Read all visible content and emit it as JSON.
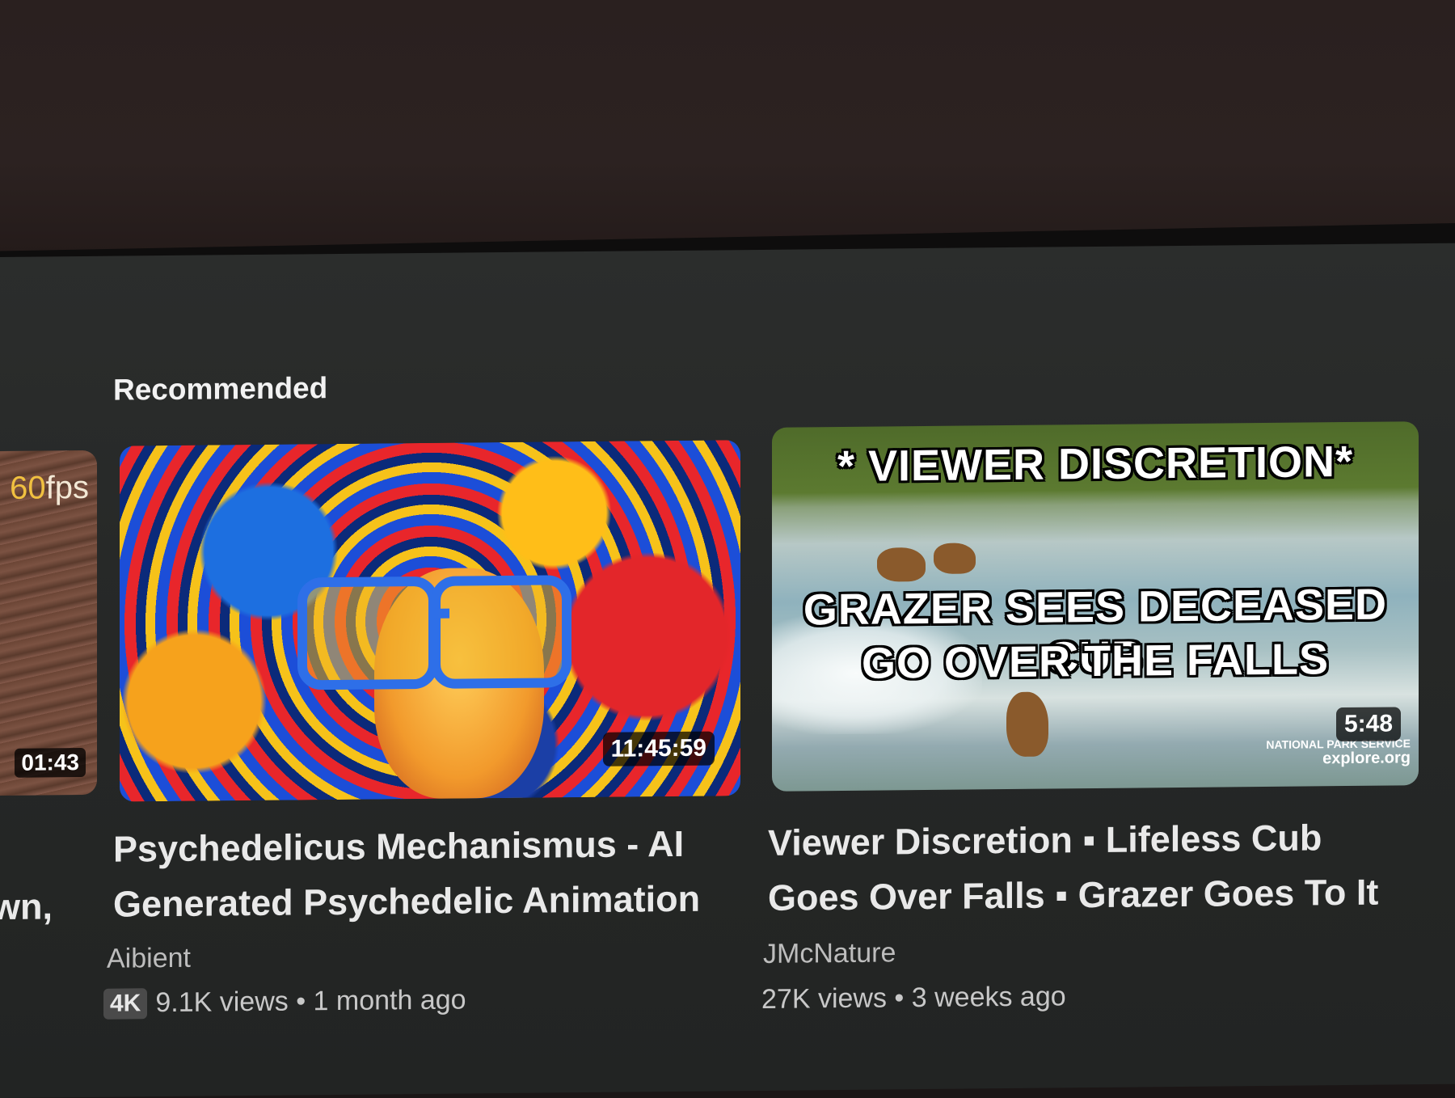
{
  "shelf": {
    "title": "Recommended"
  },
  "partial_video": {
    "quality": "60fps",
    "quality_prefix": "60",
    "quality_suffix": "fps",
    "duration": "01:43",
    "title_fragment": "wn,"
  },
  "videos": [
    {
      "title_line1": "Psychedelicus Mechanismus - AI",
      "title_line2": "Generated Psychedelic Animation",
      "channel": "Aibient",
      "badge": "4K",
      "meta": "9.1K views • 1 month ago",
      "duration": "11:45:59",
      "thumbnail_icon": "psychedelic-art-thumbnail"
    },
    {
      "title_line1": "Viewer Discretion ▪ Lifeless Cub",
      "title_line2": "Goes Over Falls ▪ Grazer Goes To It",
      "channel": "JMcNature",
      "meta": "27K views • 3 weeks ago",
      "duration": "5:48",
      "overlay_top": "* VIEWER DISCRETION*",
      "overlay_line1": "GRAZER SEES DECEASED CUB",
      "overlay_line2": "GO OVER THE FALLS",
      "watermark_line1": "NATIONAL PARK SERVICE",
      "watermark_line2": "explore.org",
      "thumbnail_icon": "bear-waterfall-thumbnail"
    }
  ],
  "colors": {
    "background": "#262827",
    "title_text": "#e9e9e9",
    "meta_text": "#c8c8c8"
  }
}
